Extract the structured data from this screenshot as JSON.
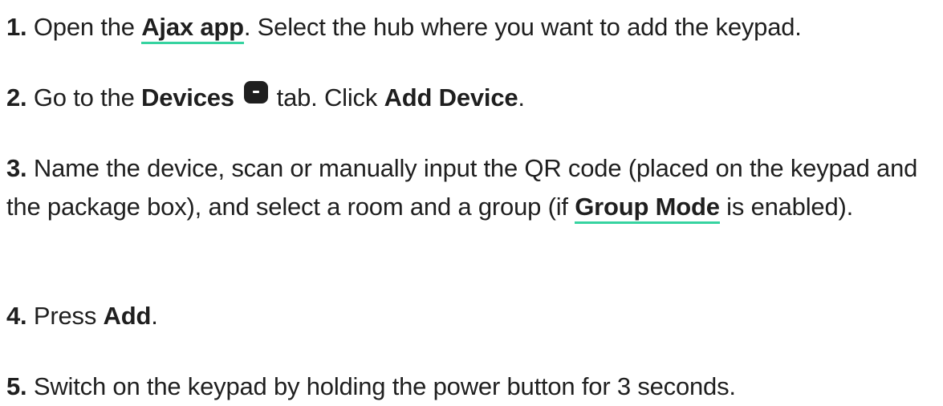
{
  "steps": [
    {
      "num": "1.",
      "t1": "Open the ",
      "link": "Ajax app",
      "t2": ". Select the hub where you want to add the keypad."
    },
    {
      "num": "2.",
      "t1": "Go to the ",
      "bold1": "Devices",
      "icon": "devices-tab-icon",
      "t2": " tab. Click ",
      "bold2": "Add Device",
      "t3": "."
    },
    {
      "num": "3.",
      "t1": "Name the device, scan or manually input the QR code (placed on the keypad and the package box), and select a room and a group (if ",
      "link": "Group Mode",
      "t2": " is enabled)."
    },
    {
      "num": "4.",
      "t1": "Press ",
      "bold1": "Add",
      "t2": "."
    },
    {
      "num": "5.",
      "t1": "Switch on the keypad by holding the power button for 3 seconds."
    }
  ],
  "colors": {
    "text": "#1f1f1f",
    "link_underline": "#36d3a0"
  }
}
